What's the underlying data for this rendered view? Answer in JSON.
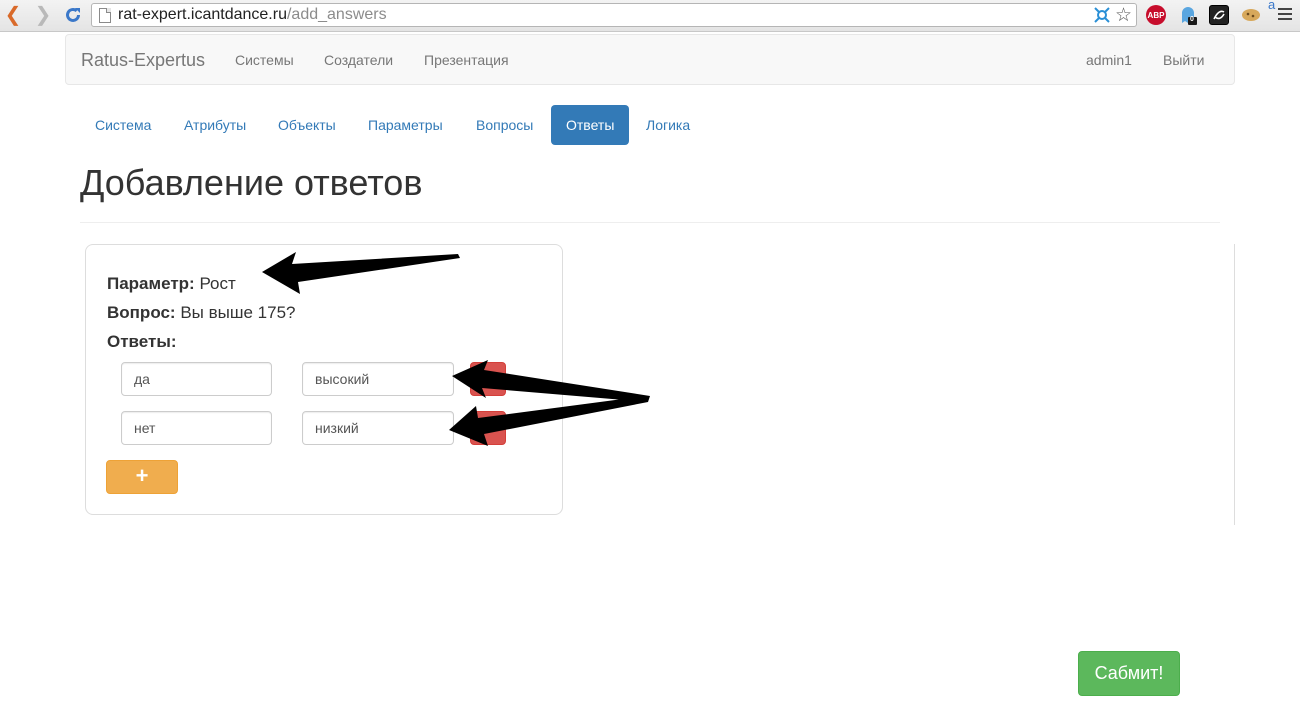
{
  "browser": {
    "url_host": "rat-expert.icantdance.ru",
    "url_path": "/add_answers",
    "extensions": [
      {
        "label": "ABP",
        "color": "#c70d2c"
      },
      {
        "label": "0",
        "color": "#1a1a1a"
      }
    ]
  },
  "navbar": {
    "brand": "Ratus-Expertus",
    "links": [
      "Системы",
      "Создатели",
      "Презентация"
    ],
    "user": "admin1",
    "logout": "Выйти"
  },
  "tabs": [
    {
      "label": "Система",
      "active": false
    },
    {
      "label": "Атрибуты",
      "active": false
    },
    {
      "label": "Объекты",
      "active": false
    },
    {
      "label": "Параметры",
      "active": false
    },
    {
      "label": "Вопросы",
      "active": false
    },
    {
      "label": "Ответы",
      "active": true
    },
    {
      "label": "Логика",
      "active": false
    }
  ],
  "page": {
    "title": "Добавление ответов"
  },
  "card": {
    "parameter_label": "Параметр:",
    "parameter_value": "Рост",
    "question_label": "Вопрос:",
    "question_value": "Вы выше 175?",
    "answers_label": "Ответы:",
    "answers": [
      {
        "answer": "да",
        "value": "высокий"
      },
      {
        "answer": "нет",
        "value": "низкий"
      }
    ],
    "add_label": "+"
  },
  "submit": {
    "label": "Сабмит!"
  },
  "colors": {
    "primary": "#337ab7",
    "danger": "#d9534f",
    "warning": "#f0ad4e",
    "success": "#5cb85c"
  }
}
